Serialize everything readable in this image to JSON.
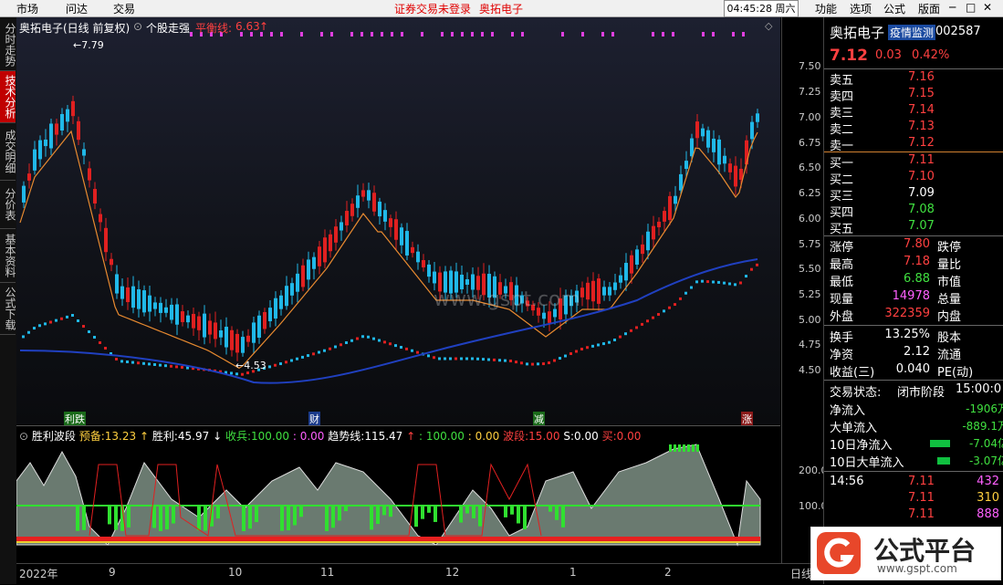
{
  "menu": {
    "market": "市场",
    "ask": "问达",
    "trade": "交易",
    "notice": "证券交易未登录",
    "stock": "奥拓电子",
    "clock": "04:45:28",
    "weekday": "周六",
    "func": "功能",
    "options": "选项",
    "formula": "公式",
    "layout": "版面"
  },
  "tabs": [
    "分时走势",
    "技术分析",
    "成交明细",
    "分价表",
    "基本资料",
    "公式下载"
  ],
  "chart": {
    "title": "奥拓电子(日线 前复权)",
    "indicator": "个股走强",
    "balance_label": "平衡线:",
    "balance_value": "6.63",
    "high_mark": "7.79",
    "low_mark": "4.53",
    "watermark": "www.gspt.com",
    "events": [
      "利跌",
      "财",
      "减",
      "涨"
    ]
  },
  "y_ticks": [
    "7.50",
    "7.25",
    "7.00",
    "6.75",
    "6.50",
    "6.25",
    "6.00",
    "5.75",
    "5.50",
    "5.25",
    "5.00",
    "4.75",
    "4.50"
  ],
  "ind": {
    "name": "胜利波段",
    "l1": "预备:",
    "v1": "13.23",
    "l2": "胜利:",
    "v2": "45.97",
    "l3": "收兵:",
    "v3": "100.00",
    "v4": ": 0.00",
    "l5": "趋势线:",
    "v5": "115.47",
    "v6": ": 100.00",
    "v7": ": 0.00",
    "l8": "波段:",
    "v8": "15.00",
    "l9": "S:",
    "v9": "0.00",
    "l10": "买:",
    "v10": "0.00",
    "ticks": [
      "200.0",
      "100.0"
    ]
  },
  "x_ticks": [
    "2022年",
    "9",
    "10",
    "11",
    "12",
    "1",
    "2"
  ],
  "x_last": "日线",
  "quote": {
    "name": "奥拓电子",
    "tag": "疫情监测",
    "code": "002587",
    "price": "7.12",
    "chg": "0.03",
    "pct": "0.42%",
    "asks": [
      {
        "l": "卖五",
        "p": "7.16"
      },
      {
        "l": "卖四",
        "p": "7.15"
      },
      {
        "l": "卖三",
        "p": "7.14"
      },
      {
        "l": "卖二",
        "p": "7.13"
      },
      {
        "l": "卖一",
        "p": "7.12"
      }
    ],
    "bids": [
      {
        "l": "买一",
        "p": "7.11"
      },
      {
        "l": "买二",
        "p": "7.10"
      },
      {
        "l": "买三",
        "p": "7.09"
      },
      {
        "l": "买四",
        "p": "7.08"
      },
      {
        "l": "买五",
        "p": "7.07"
      }
    ],
    "stats": [
      {
        "l": "涨停",
        "v": "7.80",
        "r": "跌停",
        "c": "#ff4040"
      },
      {
        "l": "最高",
        "v": "7.18",
        "r": "量比",
        "c": "#ff4040"
      },
      {
        "l": "最低",
        "v": "6.88",
        "r": "市值",
        "c": "#40e040"
      },
      {
        "l": "现量",
        "v": "14978",
        "r": "总量",
        "c": "#ff60ff"
      },
      {
        "l": "外盘",
        "v": "322359",
        "r": "内盘",
        "c": "#ff4040"
      }
    ],
    "fund": [
      {
        "l": "换手",
        "v": "13.25%",
        "r": "股本"
      },
      {
        "l": "净资",
        "v": "2.12",
        "r": "流通"
      },
      {
        "l": "收益(三)",
        "v": "0.040",
        "r": "PE(动)"
      }
    ],
    "status_label": "交易状态:",
    "status": "闭市阶段",
    "status_time": "15:00:0",
    "flows": [
      {
        "l": "净流入",
        "v": "-1906万"
      },
      {
        "l": "大单流入",
        "v": "-889.1万"
      },
      {
        "l": "10日净流入",
        "v": "-7.04亿"
      },
      {
        "l": "10日大单流入",
        "v": "-3.07亿"
      }
    ],
    "ticks": [
      {
        "t": "14:56",
        "p": "7.11",
        "v": "432",
        "vc": "#ff60ff"
      },
      {
        "t": "",
        "p": "7.11",
        "v": "310",
        "vc": "#ffd040"
      },
      {
        "t": "",
        "p": "7.11",
        "v": "888",
        "vc": "#ff60ff"
      }
    ]
  },
  "logo": {
    "text": "公式平台",
    "url": "www.gspt.com"
  }
}
